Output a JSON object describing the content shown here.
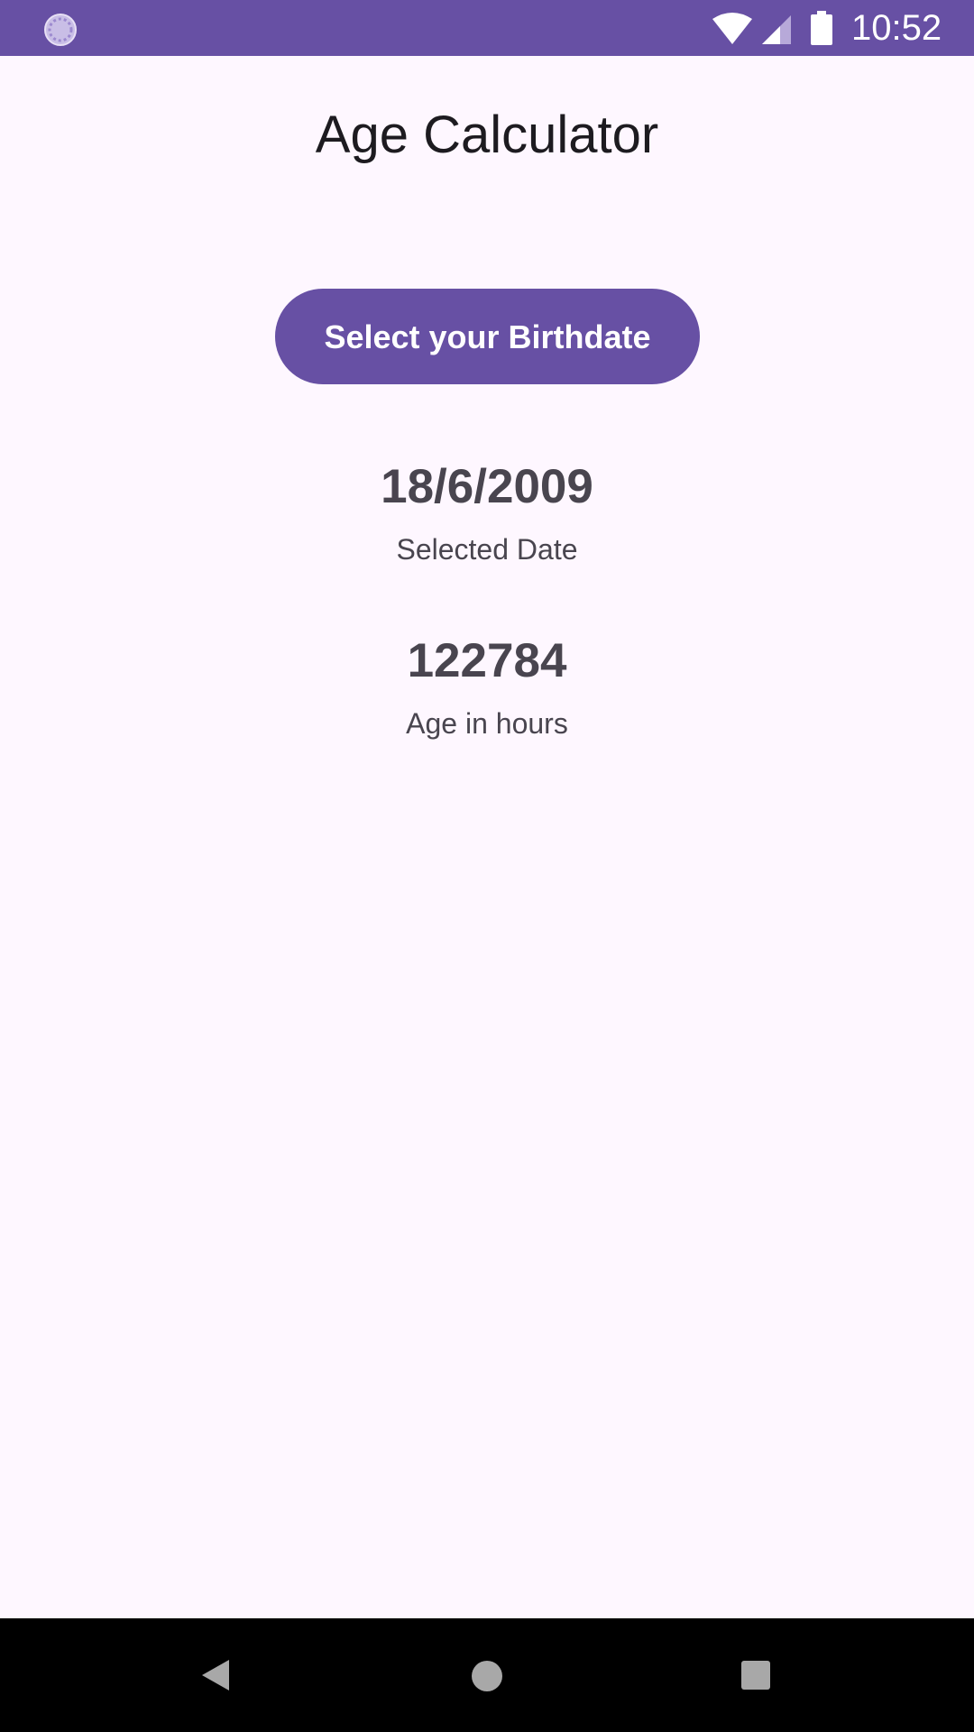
{
  "status_bar": {
    "time": "10:52",
    "left_icon": "loading-spinner-icon",
    "icons": [
      "wifi-icon",
      "signal-icon",
      "battery-icon"
    ],
    "color": "#6750A4"
  },
  "header": {
    "title": "Age Calculator"
  },
  "main": {
    "select_button_label": "Select your Birthdate",
    "selected_date_value": "18/6/2009",
    "selected_date_label": "Selected Date",
    "age_hours_value": "122784",
    "age_hours_label": "Age in hours"
  },
  "nav_bar": {
    "icons": [
      "back-icon",
      "home-icon",
      "recents-icon"
    ]
  },
  "colors": {
    "primary": "#6750A4",
    "background": "#FEF7FF",
    "on_surface": "#1D1B20",
    "on_surface_variant": "#49454F"
  }
}
